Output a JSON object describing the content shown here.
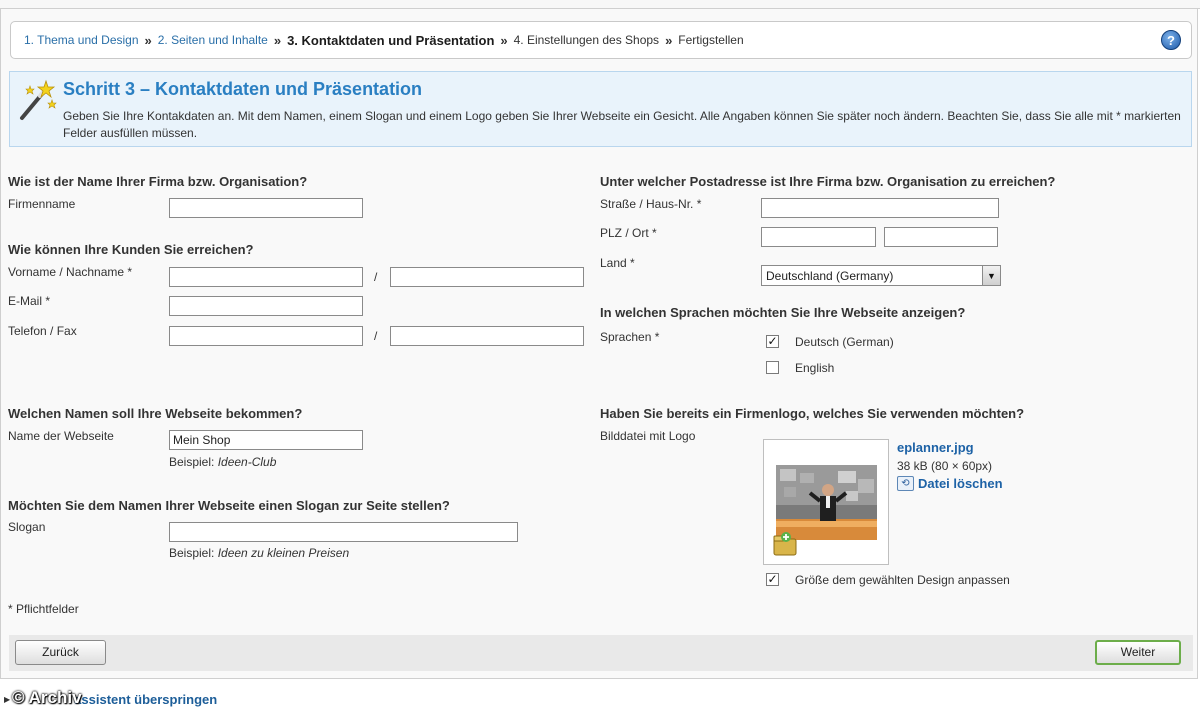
{
  "breadcrumb": {
    "steps": [
      "1. Thema und Design",
      "2. Seiten und Inhalte",
      "3. Kontaktdaten und Präsentation",
      "4. Einstellungen des Shops",
      "Fertigstellen"
    ],
    "separator": "»",
    "help_icon": "question-mark-icon",
    "help_symbol": "?"
  },
  "info": {
    "icon": "magic-wand-icon",
    "title": "Schritt 3 – Kontaktdaten und Präsentation",
    "text": "Geben Sie Ihre Kontakdaten an. Mit dem Namen, einem Slogan und einem Logo geben Sie Ihrer Webseite ein Gesicht. Alle Angaben können Sie später noch ändern. Beachten Sie, dass Sie alle mit * markierten Felder ausfüllen müssen."
  },
  "left": {
    "company_question": "Wie ist der Name Ihrer Firma bzw. Organisation?",
    "company_label": "Firmenname",
    "company_value": "",
    "contact_question": "Wie können Ihre Kunden Sie erreichen?",
    "name_label": "Vorname / Nachname *",
    "email_label": "E-Mail *",
    "phone_label": "Telefon / Fax",
    "slash": "/",
    "site_question": "Welchen Namen soll Ihre Webseite bekommen?",
    "site_label": "Name der Webseite",
    "site_value": "Mein Shop",
    "site_hint_prefix": "Beispiel: ",
    "site_hint_example": "Ideen-Club",
    "slogan_question": "Möchten Sie dem Namen Ihrer Webseite einen Slogan zur Seite stellen?",
    "slogan_label": "Slogan",
    "slogan_value": "",
    "slogan_hint_prefix": "Beispiel: ",
    "slogan_hint_example": "Ideen zu kleinen Preisen",
    "required_note": "* Pflichtfelder"
  },
  "right": {
    "address_question": "Unter welcher Postadresse ist Ihre Firma bzw. Organisation zu erreichen?",
    "street_label": "Straße / Haus-Nr. *",
    "zip_label": "PLZ / Ort *",
    "country_label": "Land *",
    "country_value": "Deutschland (Germany)",
    "dropdown_arrow": "▼",
    "lang_question": "In welchen Sprachen möchten Sie Ihre Webseite anzeigen?",
    "lang_label": "Sprachen *",
    "languages": [
      {
        "label": "Deutsch (German)",
        "checked": true
      },
      {
        "label": "English",
        "checked": false
      }
    ],
    "check_mark": "✓",
    "logo_question": "Haben Sie bereits ein Firmenlogo, welches Sie verwenden möchten?",
    "logo_label": "Bilddatei mit Logo",
    "logo_filename": "eplanner.jpg",
    "logo_size": "38 kB (80 × 60px)",
    "delete_label": "Datei löschen",
    "delete_icon": "delete-file-icon",
    "fit_label": "Größe dem gewählten Design anpassen",
    "fit_checked": true
  },
  "footer": {
    "back_label": "Zurück",
    "next_label": "Weiter"
  },
  "skip": {
    "arrow": "▶",
    "label": "assistent überspringen"
  },
  "watermark": "© Archiv"
}
